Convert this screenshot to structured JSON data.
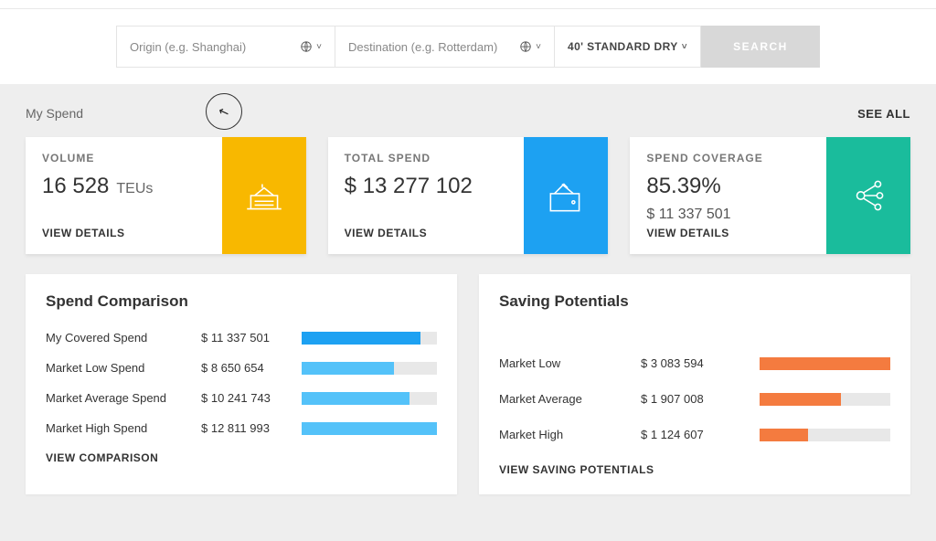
{
  "search": {
    "origin_placeholder": "Origin (e.g. Shanghai)",
    "destination_placeholder": "Destination (e.g. Rotterdam)",
    "container_label": "40' STANDARD DRY",
    "search_button": "SEARCH"
  },
  "section": {
    "title": "My Spend",
    "see_all": "SEE ALL"
  },
  "cards": {
    "volume": {
      "title": "VOLUME",
      "value": "16 528",
      "unit": "TEUs",
      "link": "VIEW DETAILS"
    },
    "total_spend": {
      "title": "TOTAL SPEND",
      "value": "$ 13 277 102",
      "link": "VIEW DETAILS"
    },
    "coverage": {
      "title": "SPEND COVERAGE",
      "percent": "85.39%",
      "amount": "$ 11 337 501",
      "link": "VIEW DETAILS"
    }
  },
  "spend_comparison": {
    "title": "Spend Comparison",
    "rows": [
      {
        "label": "My Covered Spend",
        "value": "$ 11 337 501",
        "pct": 88,
        "color": "#1da1f2"
      },
      {
        "label": "Market Low Spend",
        "value": "$ 8 650 654",
        "pct": 68,
        "color": "#54c2f9"
      },
      {
        "label": "Market Average Spend",
        "value": "$ 10 241 743",
        "pct": 80,
        "color": "#54c2f9"
      },
      {
        "label": "Market High Spend",
        "value": "$ 12 811 993",
        "pct": 100,
        "color": "#54c2f9"
      }
    ],
    "link": "VIEW COMPARISON"
  },
  "saving_potentials": {
    "title": "Saving Potentials",
    "rows": [
      {
        "label": "Market Low",
        "value": "$ 3 083 594",
        "pct": 100,
        "color": "#f47b3f"
      },
      {
        "label": "Market Average",
        "value": "$ 1 907 008",
        "pct": 62,
        "color": "#f47b3f"
      },
      {
        "label": "Market High",
        "value": "$ 1 124 607",
        "pct": 37,
        "color": "#f47b3f"
      }
    ],
    "link": "VIEW SAVING POTENTIALS"
  },
  "chart_data": [
    {
      "type": "bar",
      "title": "Spend Comparison",
      "orientation": "horizontal",
      "xlabel": "",
      "ylabel": "",
      "categories": [
        "My Covered Spend",
        "Market Low Spend",
        "Market Average Spend",
        "Market High Spend"
      ],
      "values": [
        11337501,
        8650654,
        10241743,
        12811993
      ],
      "unit": "USD"
    },
    {
      "type": "bar",
      "title": "Saving Potentials",
      "orientation": "horizontal",
      "xlabel": "",
      "ylabel": "",
      "categories": [
        "Market Low",
        "Market Average",
        "Market High"
      ],
      "values": [
        3083594,
        1907008,
        1124607
      ],
      "unit": "USD"
    }
  ]
}
